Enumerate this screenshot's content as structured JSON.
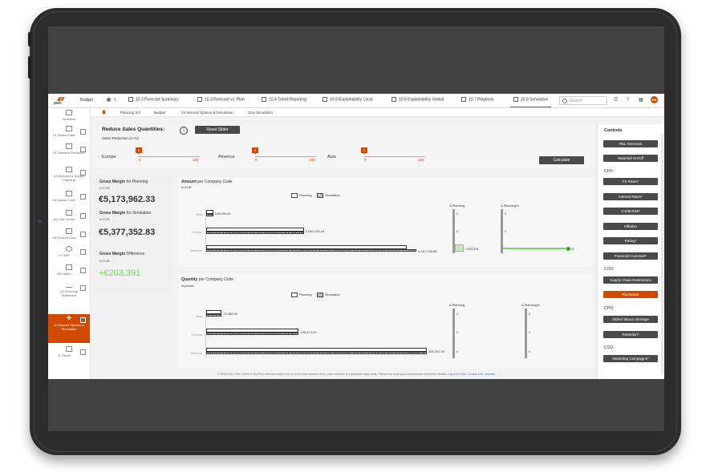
{
  "topbar": {
    "logo_text": "pwc",
    "budget_label": "Budget",
    "count": "1",
    "tabs": [
      {
        "label": "10.2 Forecast Summary"
      },
      {
        "label": "10.3 Forecast vs. Plan"
      },
      {
        "label": "10.4 Trend Reporting"
      },
      {
        "label": "10.5 Explainability Local"
      },
      {
        "label": "10.6 Explainability Global"
      },
      {
        "label": "10.7 Playbook"
      },
      {
        "label": "10.8 Simulation"
      }
    ],
    "search_placeholder": "Search",
    "avatar_initials": "ME"
  },
  "breadcrumb": [
    "Planning 5.0",
    "Budget",
    "10 Second Opinion & Simulation",
    "10.8 Simulation"
  ],
  "leftnav": [
    {
      "label": "Workflow"
    },
    {
      "label": "01 Master Data"
    },
    {
      "label": "02 Demand Prediction"
    },
    {
      "label": "03 Demand & Supply Planning"
    },
    {
      "label": "04 Labour Cost*"
    },
    {
      "label": "05 Cost Center"
    },
    {
      "label": "06 Product Cost"
    },
    {
      "label": "07 S&P"
    },
    {
      "label": "08 CapEx"
    },
    {
      "label": "09 Financial Statement"
    },
    {
      "label": "10 Second Opinion & Simulation"
    },
    {
      "label": "11 Result"
    }
  ],
  "slider_panel": {
    "title": "Reduce Sales Quantities:",
    "info_glyph": "i",
    "reset_label": "Reset Slider",
    "subtitle": "Sales Reduction (in %)",
    "regions": [
      {
        "name": "Europe",
        "value": "0",
        "min": "0",
        "max": "100"
      },
      {
        "name": "America",
        "value": "0",
        "min": "0",
        "max": "100"
      },
      {
        "name": "Asia",
        "value": "0",
        "min": "0",
        "max": "100"
      }
    ],
    "calculate_label": "Calculate"
  },
  "kpis": [
    {
      "title_bold": "Gross Margin",
      "title_rest": " for Planning",
      "unit": "in EUR",
      "value": "€5,173,962.33"
    },
    {
      "title_bold": "Gross Margin",
      "title_rest": " for Simulation",
      "unit": "in EUR",
      "value": "€5,377,352.83"
    },
    {
      "title_bold": "Gross Margin",
      "title_rest": " Difference",
      "unit": "in EUR",
      "value": "+€203,391"
    }
  ],
  "amount_chart": {
    "title_bold": "Amount",
    "title_rest": " per Company Code",
    "unit": "in EUR",
    "legend_planning": "Planning",
    "legend_simulation": "Simulation",
    "delta_planning": "Δ Planning",
    "delta_planning_pct": "Δ Planning%",
    "zero": "0",
    "categories": [
      "Asia",
      "Europe",
      "America"
    ],
    "labels": [
      "146,990.81",
      "2,040,126.44",
      "4,187,235.58"
    ],
    "delta_value": "+203,391",
    "delta_pct": "+5"
  },
  "quantity_chart": {
    "title_bold": "Quantity",
    "title_rest": " per Company Code",
    "unit": "in pieces",
    "legend_planning": "Planning",
    "legend_simulation": "Simulation",
    "delta_planning": "Δ Planning",
    "delta_planning_pct": "Δ Planning%",
    "zero": "0",
    "categories": [
      "Asia",
      "Europe",
      "America"
    ],
    "labels": [
      "22,988.00",
      "136,874.00",
      "326,002.00"
    ]
  },
  "chart_data": [
    {
      "type": "bar",
      "title": "Amount per Company Code",
      "unit": "in EUR",
      "categories": [
        "Asia",
        "Europe",
        "America"
      ],
      "series": [
        {
          "name": "Planning",
          "values": [
            146990.81,
            2040126.44,
            4187235.58
          ]
        },
        {
          "name": "Simulation",
          "values": [
            146990.81,
            2040126.44,
            4390626
          ]
        }
      ],
      "delta_planning": [
        0,
        0,
        203391
      ],
      "delta_planning_pct": [
        0,
        0,
        5
      ],
      "legend": "top"
    },
    {
      "type": "bar",
      "title": "Quantity per Company Code",
      "unit": "in pieces",
      "categories": [
        "Asia",
        "Europe",
        "America"
      ],
      "series": [
        {
          "name": "Planning",
          "values": [
            22988,
            136874,
            326002
          ]
        },
        {
          "name": "Simulation",
          "values": [
            22988,
            136874,
            326002
          ]
        }
      ],
      "delta_planning": [
        0,
        0,
        0
      ],
      "delta_planning_pct": [
        0,
        0,
        0
      ],
      "legend": "top"
    }
  ],
  "controls": {
    "title": "Controls",
    "items": [
      {
        "type": "button",
        "label": "P&L Overview"
      },
      {
        "type": "button",
        "label": "Waterfall On/Off"
      },
      {
        "type": "label",
        "label": "CFO:"
      },
      {
        "type": "button",
        "label": "FX Rates*"
      },
      {
        "type": "button",
        "label": "Interest Rates*"
      },
      {
        "type": "button",
        "label": "Credit Risk*"
      },
      {
        "type": "button",
        "label": "Inflation"
      },
      {
        "type": "button",
        "label": "Rating*"
      },
      {
        "type": "button",
        "label": "Financial Covenant*"
      },
      {
        "type": "label",
        "label": "COO:"
      },
      {
        "type": "button",
        "label": "Supply Chain Restrictions"
      },
      {
        "type": "button",
        "label": "Recession",
        "active": true
      },
      {
        "type": "label",
        "label": "CPO:"
      },
      {
        "type": "button",
        "label": "Skilled labour shortage"
      },
      {
        "type": "button",
        "label": "Retention*"
      },
      {
        "type": "label",
        "label": "CSO:"
      },
      {
        "type": "button",
        "label": "Marketing Campaigns*"
      }
    ]
  },
  "footer": {
    "text": "© 2020 PwC. PwC refers to the PwC network and/or one or more of its member firms, each of which is a separate legal entity. Please see www.pwc.com/structure for further details.",
    "link": "Log in for SAC. Cookie-Info: 'cookies'"
  },
  "colors": {
    "accent": "#d04a02",
    "positive": "#7dd06a",
    "button": "#4a4a4a"
  }
}
